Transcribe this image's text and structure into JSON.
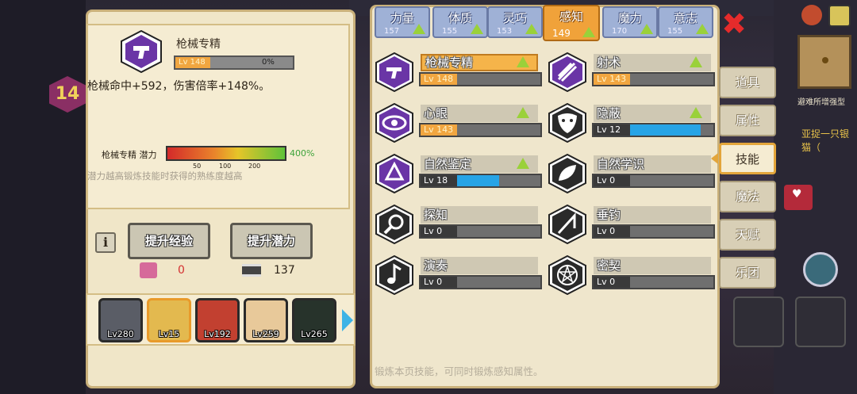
{
  "detail": {
    "skill_name": "枪械专精",
    "level_label": "Lv 148",
    "progress_text": "0%",
    "effect": "枪械命中+592，伤害倍率+148%。",
    "potential_label": "枪械专精 潜力",
    "potential_percent": "400%",
    "potential_ticks": [
      "50",
      "100",
      "200"
    ],
    "potential_note": "潜力越高锻炼技能时获得的熟练度越高",
    "info_icon_glyph": "i",
    "exp_button": "提升经验",
    "potential_button": "提升潜力",
    "exp_count": "0",
    "potential_count": "137"
  },
  "characters": [
    {
      "level": "Lv280",
      "color": "#5a5d66"
    },
    {
      "level": "Lv15",
      "color": "#e3b94f"
    },
    {
      "level": "Lv192",
      "color": "#c24030"
    },
    {
      "level": "Lv259",
      "color": "#e8c99a"
    },
    {
      "level": "Lv265",
      "color": "#27332b"
    }
  ],
  "attributes": [
    {
      "name": "力量",
      "value": "157"
    },
    {
      "name": "体质",
      "value": "155"
    },
    {
      "name": "灵巧",
      "value": "153"
    },
    {
      "name": "感知",
      "value": "149",
      "active": true
    },
    {
      "name": "魔力",
      "value": "170"
    },
    {
      "name": "意志",
      "value": "155"
    }
  ],
  "close_glyph": "✖",
  "skills": [
    {
      "name": "枪械专精",
      "level": "Lv 148",
      "fill": 0,
      "up": true,
      "selected": true,
      "icon": "gun-icon"
    },
    {
      "name": "射术",
      "level": "Lv 143",
      "fill": 0,
      "up": true,
      "icon": "arrows-icon"
    },
    {
      "name": "心眼",
      "level": "Lv 143",
      "fill": 0,
      "up": true,
      "icon": "eye-icon"
    },
    {
      "name": "隐蔽",
      "level": "Lv 12",
      "fill": 0.85,
      "up": true,
      "icon": "mask-icon"
    },
    {
      "name": "自然鉴定",
      "level": "Lv 18",
      "fill": 0.5,
      "up": true,
      "icon": "triquetra-icon"
    },
    {
      "name": "自然学识",
      "level": "Lv 0",
      "fill": 0,
      "up": false,
      "icon": "leaf-icon"
    },
    {
      "name": "探知",
      "level": "Lv 0",
      "fill": 0,
      "up": false,
      "icon": "magnifier-icon"
    },
    {
      "name": "垂钓",
      "level": "Lv 0",
      "fill": 0,
      "up": false,
      "icon": "fishing-rod-icon"
    },
    {
      "name": "演奏",
      "level": "Lv 0",
      "fill": 0,
      "up": false,
      "icon": "music-note-icon"
    },
    {
      "name": "密契",
      "level": "Lv 0",
      "fill": 0,
      "up": false,
      "icon": "pentagram-icon"
    }
  ],
  "footer_note": "锻炼本页技能，可同时锻炼感知属性。",
  "side_tabs": [
    {
      "label": "道具"
    },
    {
      "label": "属性"
    },
    {
      "label": "技能",
      "active": true
    },
    {
      "label": "魔法"
    },
    {
      "label": "天赋"
    },
    {
      "label": "乐团"
    }
  ],
  "hud": {
    "hint": "避难所增强型",
    "quest": "亚捉一只银猫（",
    "player_level": "14"
  },
  "colors": {
    "panel": "#efe6cc",
    "tab": "#9fb1d6",
    "tab_active": "#f0a23a",
    "upgrade": "#9ad13a",
    "progress": "#27a4e6"
  }
}
